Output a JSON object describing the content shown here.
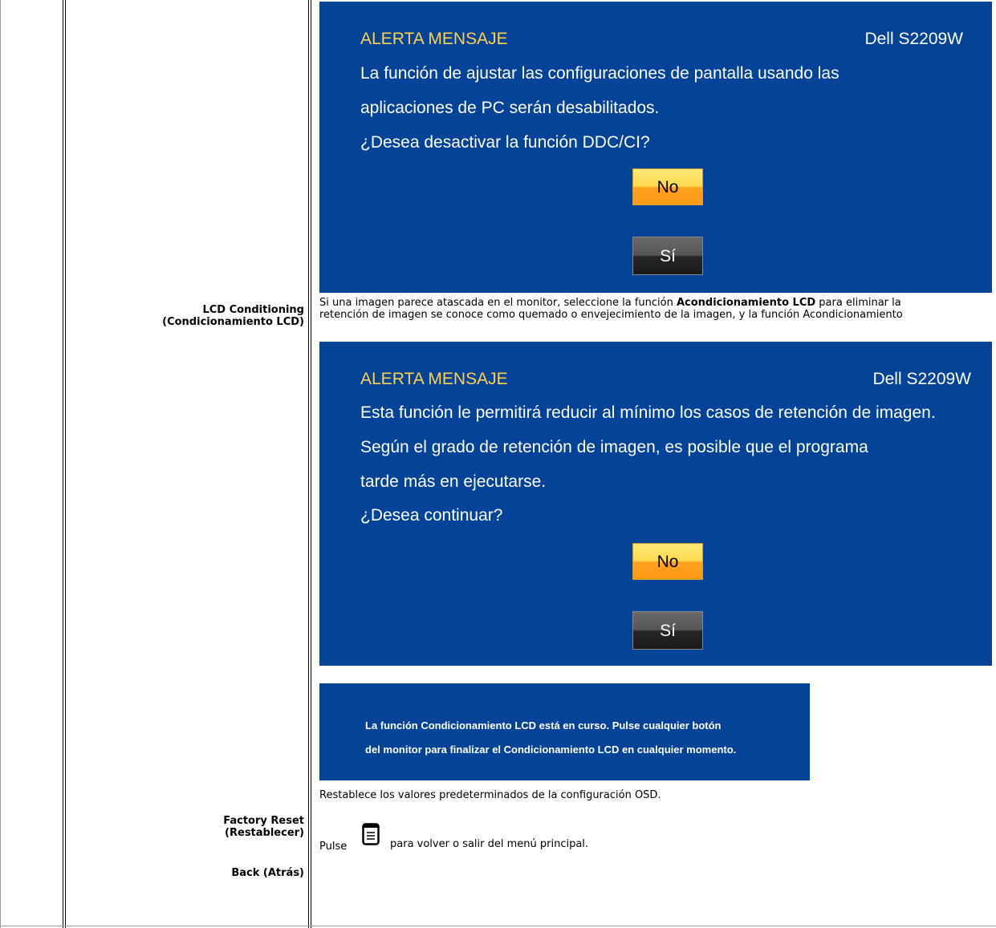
{
  "rows": {
    "lcd_conditioning": {
      "label_line1": "LCD Conditioning",
      "label_line2": "(Condicionamiento LCD)",
      "description_line1_pre": "Si una imagen parece atascada en el monitor, seleccione la función ",
      "description_line1_bold": "Acondicionamiento LCD",
      "description_line1_post": " para eliminar la",
      "description_line2": "retención de imagen se conoce como quemado o envejecimiento de la imagen, y la función Acondicionamiento"
    },
    "factory_reset": {
      "label_line1": "Factory Reset",
      "label_line2": "(Restablecer)",
      "description": "Restablece los valores predeterminados de la configuración OSD."
    },
    "back": {
      "label": "Back (Atrás)",
      "description_pre": "Pulse",
      "description_post": "para volver o salir del menú principal.",
      "icon": "menu-icon"
    }
  },
  "osd_ddc": {
    "title": "ALERTA MENSAJE",
    "model": "Dell S2209W",
    "lines": [
      "La función de ajustar las configuraciones de pantalla usando las",
      "aplicaciones de PC serán desabilitados.",
      "¿Desea desactivar la función DDC/CI?"
    ],
    "no_label": "No",
    "yes_label": "Sí"
  },
  "osd_lcd": {
    "title": "ALERTA MENSAJE",
    "model": "Dell S2209W",
    "lines": [
      "Esta función le permitirá reducir al mínimo los casos de retención de imagen.",
      "Según el grado de retención de imagen, es posible que el programa",
      "tarde más en ejecutarse.",
      "¿Desea continuar?"
    ],
    "no_label": "No",
    "yes_label": "Sí"
  },
  "osd_progress": {
    "lines": [
      "La función Condicionamiento LCD está en curso. Pulse cualquier botón",
      "del monitor para finalizar el Condicionamiento LCD en cualquier momento."
    ]
  },
  "colors": {
    "osd_background": "#044397",
    "osd_title": "#ffd24a",
    "no_button": "#ffa21f",
    "yes_button": "#262626"
  }
}
